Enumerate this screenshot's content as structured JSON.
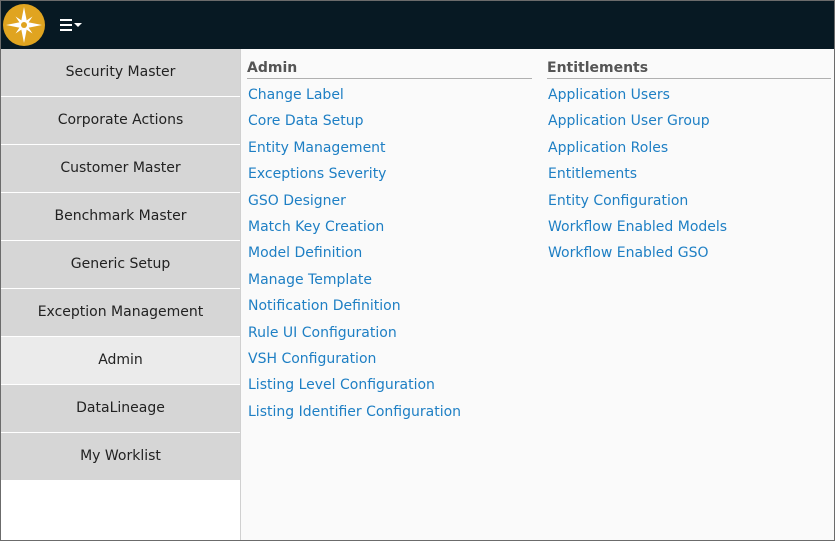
{
  "topbar": {
    "logo_icon": "compass-star-icon",
    "menu_icon": "hamburger-dropdown-icon"
  },
  "sidebar": {
    "items": [
      {
        "label": "Security Master"
      },
      {
        "label": "Corporate Actions"
      },
      {
        "label": "Customer Master"
      },
      {
        "label": "Benchmark Master"
      },
      {
        "label": "Generic Setup"
      },
      {
        "label": "Exception Management"
      },
      {
        "label": "Admin",
        "active": true
      },
      {
        "label": "DataLineage"
      },
      {
        "label": "My Worklist"
      }
    ]
  },
  "admin": {
    "heading": "Admin",
    "links": [
      "Change Label",
      "Core Data Setup",
      "Entity Management",
      "Exceptions Severity",
      "GSO Designer",
      "Match Key Creation",
      "Model Definition",
      "Manage Template",
      "Notification Definition",
      "Rule UI Configuration",
      "VSH Configuration",
      "Listing Level Configuration",
      "Listing Identifier Configuration"
    ]
  },
  "entitlements": {
    "heading": "Entitlements",
    "links": [
      "Application Users",
      "Application User Group",
      "Application Roles",
      "Entitlements",
      "Entity Configuration",
      "Workflow Enabled Models",
      "Workflow Enabled GSO"
    ]
  },
  "colors": {
    "topbar": "#071923",
    "logo": "#e0a420",
    "link": "#1e7fc4",
    "sidebar_item": "#d6d6d6",
    "sidebar_active": "#ebebeb"
  }
}
